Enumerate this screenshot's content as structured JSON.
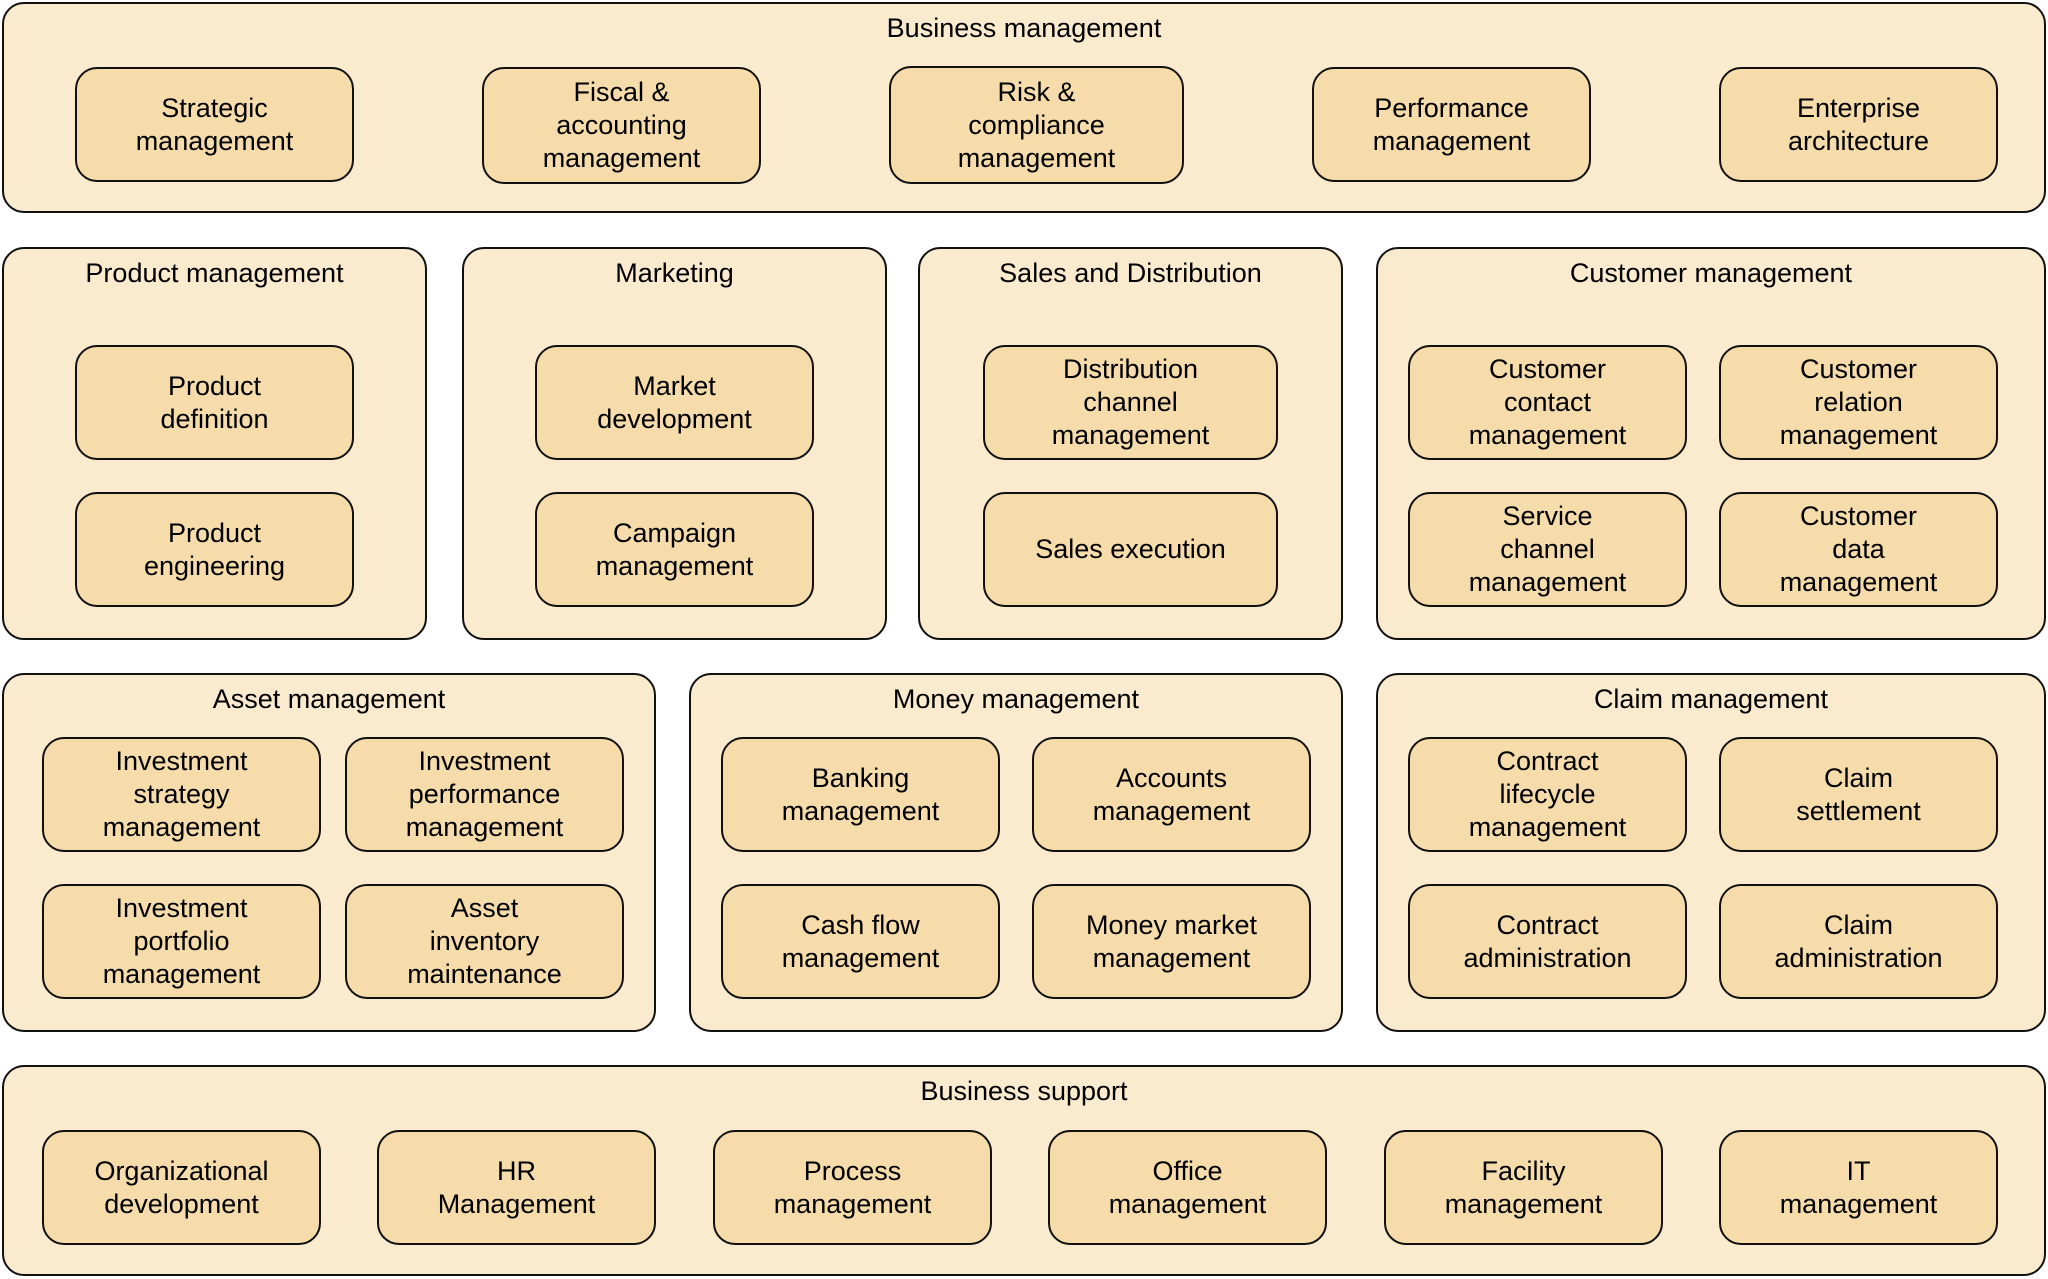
{
  "diagram": {
    "colors": {
      "group_fill": "#faebcf",
      "capability_fill": "#f5dcaa",
      "border": "#111111"
    },
    "groups": {
      "business_management": {
        "title": "Business management",
        "items": [
          "Strategic\nmanagement",
          "Fiscal &\naccounting\nmanagement",
          "Risk &\ncompliance\nmanagement",
          "Performance\nmanagement",
          "Enterprise\narchitecture"
        ]
      },
      "product_management": {
        "title": "Product management",
        "items": [
          "Product\ndefinition",
          "Product\nengineering"
        ]
      },
      "marketing": {
        "title": "Marketing",
        "items": [
          "Market\ndevelopment",
          "Campaign\nmanagement"
        ]
      },
      "sales_distribution": {
        "title": "Sales and Distribution",
        "items": [
          "Distribution\nchannel\nmanagement",
          "Sales execution"
        ]
      },
      "customer_management": {
        "title": "Customer management",
        "items": [
          "Customer\ncontact\nmanagement",
          "Customer\nrelation\nmanagement",
          "Service\nchannel\nmanagement",
          "Customer\ndata\nmanagement"
        ]
      },
      "asset_management": {
        "title": "Asset management",
        "items": [
          "Investment\nstrategy\nmanagement",
          "Investment\nperformance\nmanagement",
          "Investment\nportfolio\nmanagement",
          "Asset\ninventory\nmaintenance"
        ]
      },
      "money_management": {
        "title": "Money management",
        "items": [
          "Banking\nmanagement",
          "Accounts\nmanagement",
          "Cash flow\nmanagement",
          "Money market\nmanagement"
        ]
      },
      "claim_management": {
        "title": "Claim management",
        "items": [
          "Contract\nlifecycle\nmanagement",
          "Claim\nsettlement",
          "Contract\nadministration",
          "Claim\nadministration"
        ]
      },
      "business_support": {
        "title": "Business support",
        "items": [
          "Organizational\ndevelopment",
          "HR\nManagement",
          "Process\nmanagement",
          "Office\nmanagement",
          "Facility\nmanagement",
          "IT\nmanagement"
        ]
      }
    }
  }
}
